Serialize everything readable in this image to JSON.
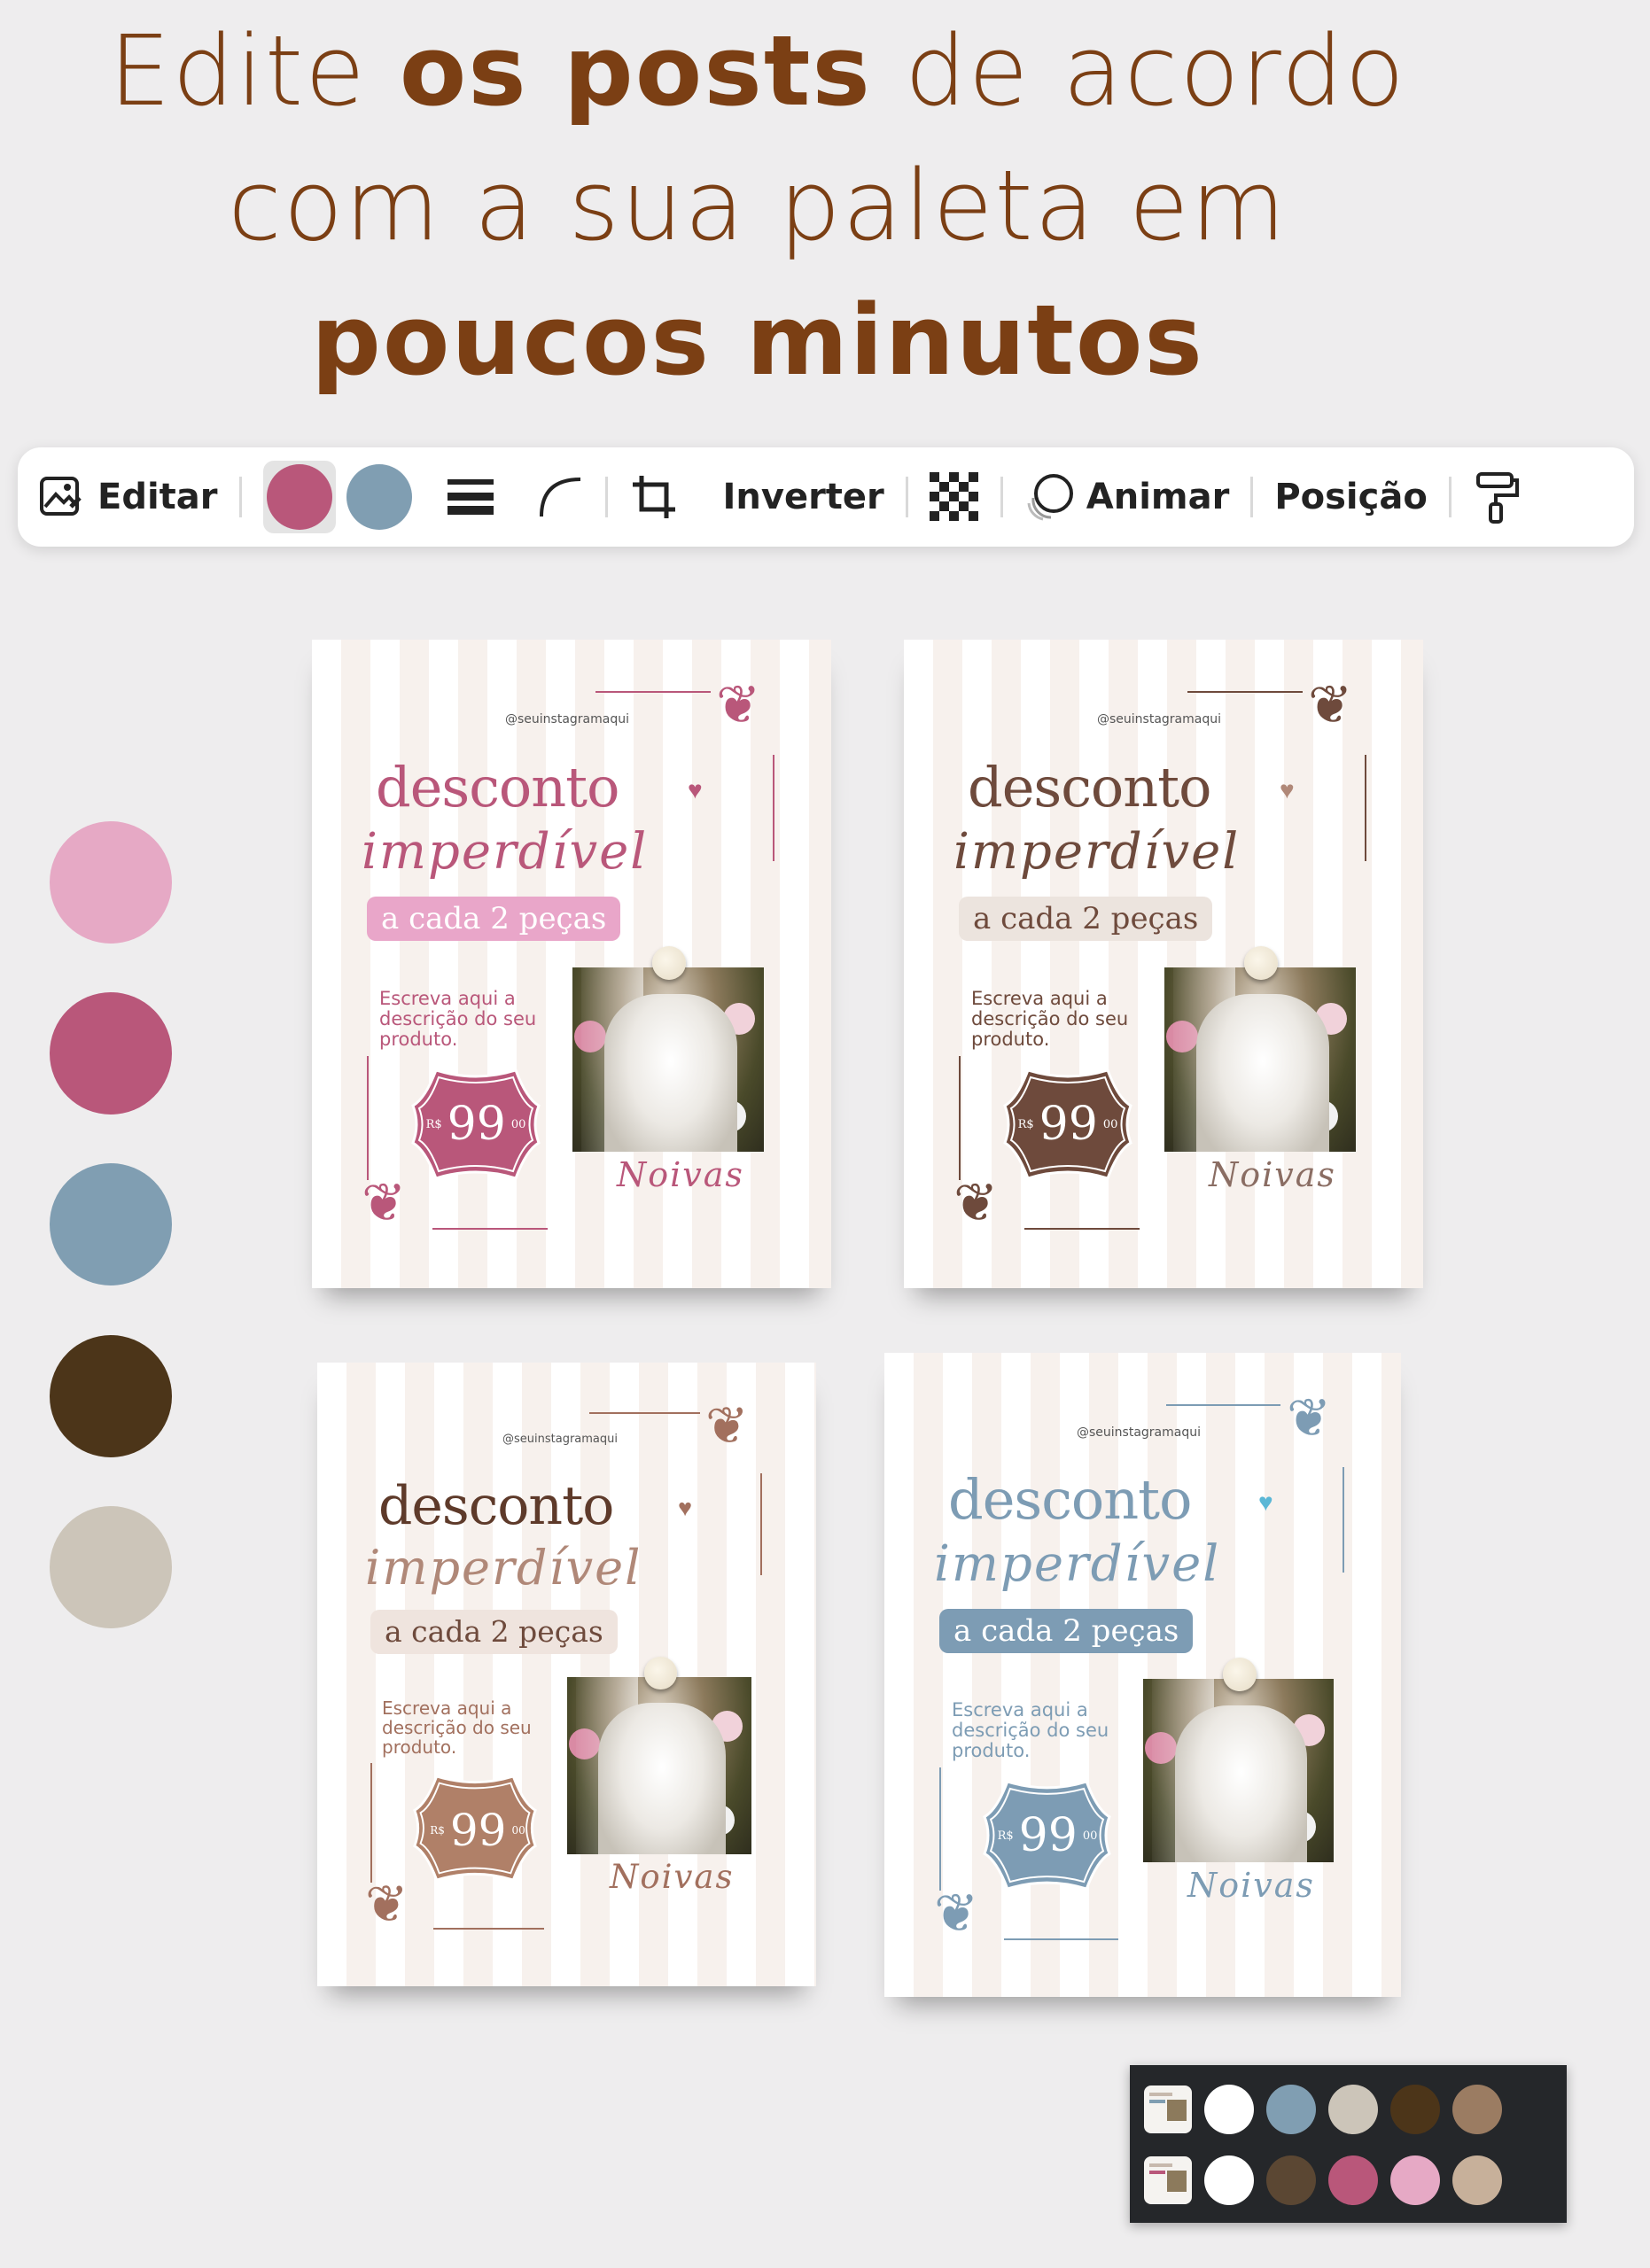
{
  "headline": {
    "line1_pre": "Edite ",
    "line1_bold": "os posts",
    "line1_post": " de acordo",
    "line2": "com a sua paleta em",
    "line3_bold": "poucos minutos"
  },
  "toolbar": {
    "edit_label": "Editar",
    "edit_icon": "image-edit-icon",
    "swatches": [
      "#b9577a",
      "#809eb2"
    ],
    "flip_label": "Inverter",
    "animate_label": "Animar",
    "position_label": "Posição"
  },
  "palette": [
    "#e6a9c5",
    "#b9577a",
    "#809eb2",
    "#4c3519",
    "#ccc5b9"
  ],
  "posts": [
    {
      "handle": "@seuinstagramaqui",
      "title": "desconto",
      "subtitle": "imperdível",
      "pill": "a cada 2 peças",
      "desc": "Escreva aqui a descrição do seu produto.",
      "currency": "R$",
      "price": "99",
      "cents": "00",
      "caption": "Noivas",
      "colors": {
        "title": "#b9577a",
        "subtitle": "#b9577a",
        "pill_bg": "#e9a6c9",
        "pill_text": "#ffffff",
        "desc": "#b9577a",
        "tag": "#b9577a",
        "heart": "#b9577a",
        "lines": "#b9577a",
        "caption": "#b9577a"
      }
    },
    {
      "handle": "@seuinstagramaqui",
      "title": "desconto",
      "subtitle": "imperdível",
      "pill": "a cada 2 peças",
      "desc": "Escreva aqui a descrição do seu produto.",
      "currency": "R$",
      "price": "99",
      "cents": "00",
      "caption": "Noivas",
      "colors": {
        "title": "#6e4a3c",
        "subtitle": "#6e4a3c",
        "pill_bg": "#ece4de",
        "pill_text": "#6e4a3c",
        "desc": "#6e4a3c",
        "tag": "#6e4a3c",
        "heart": "#b08878",
        "lines": "#6e4a3c",
        "caption": "#8a6d63"
      }
    },
    {
      "handle": "@seuinstagramaqui",
      "title": "desconto",
      "subtitle": "imperdível",
      "pill": "a cada 2 peças",
      "desc": "Escreva aqui a descrição do seu produto.",
      "currency": "R$",
      "price": "99",
      "cents": "00",
      "caption": "Noivas",
      "colors": {
        "title": "#5e3a2a",
        "subtitle": "#b08878",
        "pill_bg": "#efe4de",
        "pill_text": "#6e4a3c",
        "desc": "#a2705e",
        "tag": "#b08068",
        "heart": "#a2705e",
        "lines": "#a2705e",
        "caption": "#a2705e"
      }
    },
    {
      "handle": "@seuinstagramaqui",
      "title": "desconto",
      "subtitle": "imperdível",
      "pill": "a cada 2 peças",
      "desc": "Escreva aqui a descrição do seu produto.",
      "currency": "R$",
      "price": "99",
      "cents": "00",
      "caption": "Noivas",
      "colors": {
        "title": "#7d9cb4",
        "subtitle": "#7d9cb4",
        "pill_bg": "#7d9cb4",
        "pill_text": "#ffffff",
        "desc": "#7d9cb4",
        "tag": "#7d9cb4",
        "heart": "#5bb7d6",
        "lines": "#7d9cb4",
        "caption": "#7d9cb4"
      }
    }
  ],
  "widget": {
    "row1": [
      "#ffffff",
      "#809eb2",
      "#ccc5b9",
      "#4c3519",
      "#9b7c62"
    ],
    "row2": [
      "#ffffff",
      "#5b4733",
      "#b9577a",
      "#e6a9c5",
      "#c7b09a"
    ]
  }
}
